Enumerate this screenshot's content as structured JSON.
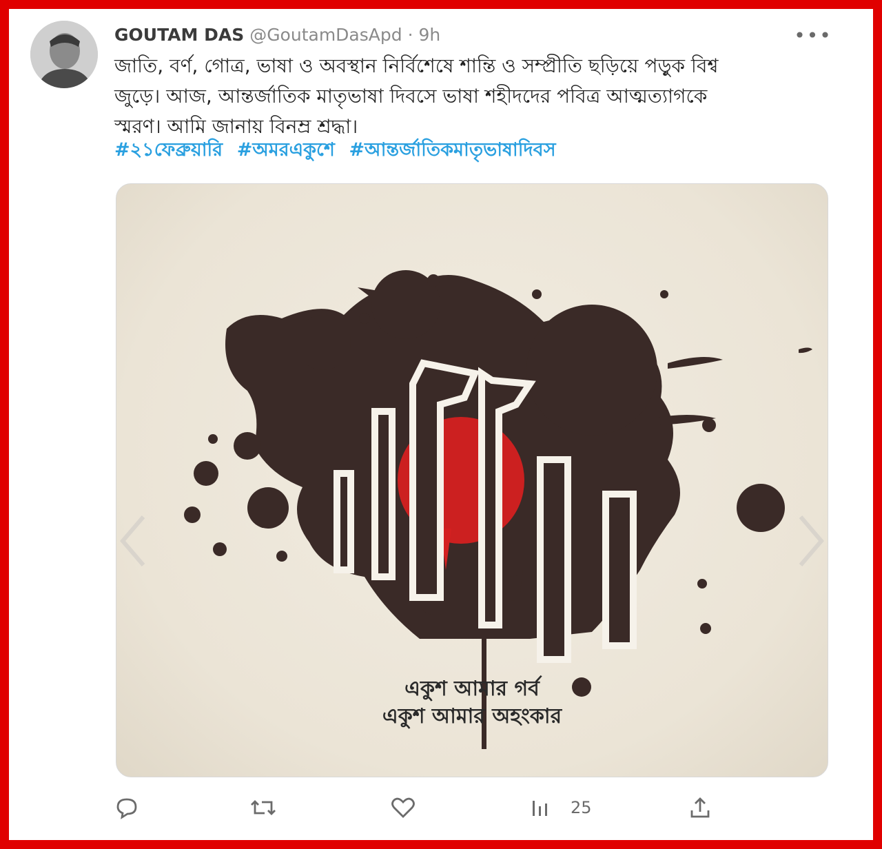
{
  "tweet": {
    "author_name": "GOUTAM DAS",
    "handle": "@GoutamDasApd",
    "separator": "·",
    "time": "9h",
    "more_label": "•••",
    "text_lines": [
      "জাতি, বর্ণ, গোত্র, ভাষা ও অবস্থান নির্বিশেষে শান্তি ও সম্প্রীতি ছড়িয়ে পড়ুক বিশ্ব",
      "জুড়ে। আজ, আন্তর্জাতিক মাতৃভাষা দিবসে ভাষা শহীদদের পবিত্র আত্মত্যাগকে",
      "স্মরণ। আমি জানায় বিনম্র শ্রদ্ধা।"
    ],
    "hashtags": [
      "#২১ফেব্রুয়ারি",
      "#অমরএকুশে",
      "#আন্তর্জাতিকমাতৃভাষাদিবস"
    ]
  },
  "media": {
    "caption_line1": "একুশ আমার গর্ব",
    "caption_line2": "একুশ আমার অহংকার",
    "colors": {
      "ink": "#3a2a27",
      "red": "#d42020",
      "paper": "#ede6d8",
      "pillar": "#f6f2ea"
    }
  },
  "actions": {
    "reply_icon": "reply-icon",
    "retweet_icon": "retweet-icon",
    "like_icon": "like-icon",
    "views_icon": "views-icon",
    "views_count": "25",
    "share_icon": "share-icon"
  },
  "colors": {
    "frame_border": "#e00000",
    "link": "#2aa0e0",
    "muted": "#8a8a8a"
  }
}
